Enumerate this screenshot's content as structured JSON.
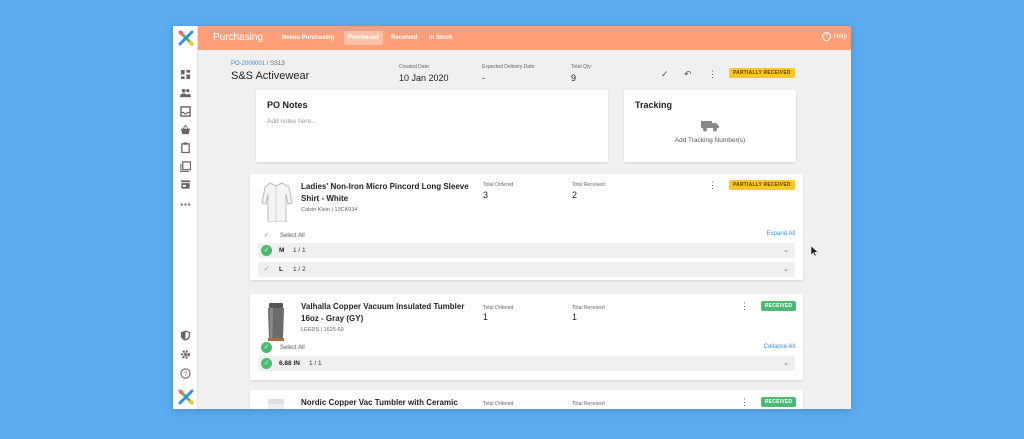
{
  "nav": {
    "title": "Purchasing",
    "tabs": [
      "Needs Purchasing",
      "Purchased",
      "Received",
      "In Stock"
    ],
    "active_tab": "Purchased",
    "help": "Help"
  },
  "rail_icons": [
    "dashboard-icon",
    "people-icon",
    "inbox-icon",
    "basket-icon",
    "clipboard-icon",
    "library-icon",
    "store-icon",
    "more-icon",
    "shield-icon",
    "settings-icon",
    "help-icon"
  ],
  "po": {
    "number": "PO-2000001",
    "suffix": " / SS13",
    "vendor": "S&S Activewear",
    "created_label": "Created Date:",
    "created_value": "10 Jan 2020",
    "delivery_label": "Expected Delivery Date:",
    "delivery_value": "-",
    "qty_label": "Total Qty:",
    "qty_value": "9",
    "status": "PARTIALLY RECEIVED"
  },
  "notes": {
    "title": "PO Notes",
    "placeholder": "Add notes here..."
  },
  "tracking": {
    "title": "Tracking",
    "add": "Add Tracking Number(s)"
  },
  "items": [
    {
      "name": "Ladies' Non-Iron Micro Pincord Long Sleeve Shirt - White",
      "sku": "Calvin Klein | 13CK034",
      "ordered_label": "Total Ordered",
      "ordered": "3",
      "received_label": "Total Received",
      "received": "2",
      "status": "PARTIALLY RECEIVED",
      "select_all": "Select All",
      "toggle": "Expand All",
      "variants": [
        {
          "size": "M",
          "count": "1 / 1",
          "done": true
        },
        {
          "size": "L",
          "count": "1 / 2",
          "done": false
        }
      ]
    },
    {
      "name": "Valhalla Copper Vacuum Insulated Tumbler 16oz - Gray (GY)",
      "sku": "LEEDS | 1625-69",
      "ordered_label": "Total Ordered",
      "ordered": "1",
      "received_label": "Total Received",
      "received": "1",
      "status": "RECEIVED",
      "select_all": "Select All",
      "toggle": "Collapse All",
      "variants": [
        {
          "size": "6.88 IN",
          "count": "1 / 1",
          "done": true
        }
      ]
    },
    {
      "name": "Nordic Copper Vac Tumbler with Ceramic",
      "ordered_label": "Total Ordered",
      "received_label": "Total Received",
      "status": "RECEIVED"
    }
  ],
  "colors": {
    "accent": "#ff9f7a",
    "link": "#3a8ed8",
    "partial": "#ffc72c",
    "received": "#4cba72",
    "background": "#5aabf0"
  }
}
